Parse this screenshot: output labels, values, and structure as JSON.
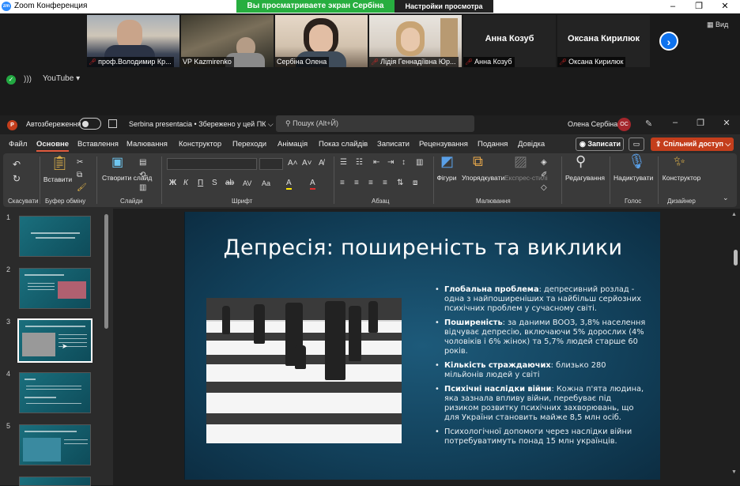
{
  "zoom": {
    "app_title": "Zoom Конференция",
    "app_icon": "zm",
    "share_banner": "Вы просматриваете экран Сербіна Олена",
    "view_settings": "Настройки просмотра",
    "participants": [
      {
        "name": "проф.Володимир Кр...",
        "muted": true,
        "has_video": true
      },
      {
        "name": "VP Kazmirenko",
        "muted": false,
        "has_video": true
      },
      {
        "name": "Сербіна Олена",
        "muted": false,
        "has_video": true
      },
      {
        "name": "Лідія Геннадіївна Юр...",
        "muted": true,
        "has_video": true
      },
      {
        "name": "Анна Козуб",
        "display_name": "Анна Козуб",
        "muted": true,
        "has_video": false
      },
      {
        "name": "Оксана Кирилюк",
        "display_name": "Оксана Кирилюк",
        "muted": true,
        "has_video": false
      }
    ],
    "next_arrow": "›",
    "view_label": "Вид",
    "youtube_label": "YouTube ▾",
    "window_controls": [
      "–",
      "❐",
      "✕"
    ]
  },
  "ppt": {
    "logo": "P",
    "autosave_label": "Автозбереження",
    "doc_title": "Serbina presentacia • Збережено у цей ПК ⌵",
    "search_placeholder": "Пошук (Alt+Й)",
    "user_name": "Олена Сербіна",
    "user_initials": "ОС",
    "window_controls": [
      "–",
      "❐",
      "✕"
    ],
    "menu": [
      "Файл",
      "Основне",
      "Вставлення",
      "Малювання",
      "Конструктор",
      "Переходи",
      "Анімація",
      "Показ слайдів",
      "Записати",
      "Рецензування",
      "Подання",
      "Довідка"
    ],
    "active_menu": "Основне",
    "record_label": "◉ Записати",
    "comment_label": "▭",
    "share_label": "⇪ Спільний доступ ⌵",
    "ribbon": {
      "undo_group": "Скасувати",
      "clipboard_group": "Буфер обміну",
      "paste_label": "Вставити",
      "slides_group": "Слайди",
      "new_slide_label": "Створити слайд",
      "font_group": "Шрифт",
      "paragraph_group": "Абзац",
      "drawing_group": "Малювання",
      "shapes_label": "Фігури",
      "arrange_label": "Упорядкувати",
      "quick_styles_label": "Експрес-стилі",
      "editing_group": "",
      "editing_label": "Редагування",
      "voice_group": "Голос",
      "dictate_label": "Надиктувати",
      "designer_group": "Дизайнер",
      "designer_label": "Конструктор",
      "font_buttons": [
        "Ж",
        "К",
        "П",
        "S",
        "ab",
        "AV",
        "Aa",
        "A",
        "A"
      ]
    },
    "slides": [
      {
        "num": "1"
      },
      {
        "num": "2"
      },
      {
        "num": "3"
      },
      {
        "num": "4"
      },
      {
        "num": "5"
      }
    ],
    "selected_slide": "3",
    "current_slide": {
      "title": "Депресія: поширеність та виклики",
      "bullets": [
        {
          "bold": "Глобальна проблема",
          "text": ": депресивний розлад - одна з найпоширеніших та найбільш серйозних психічних проблем у сучасному світі."
        },
        {
          "bold": "Поширеність",
          "text": ": за даними ВООЗ, 3,8% населення відчуває депресію, включаючи 5% дорослих (4% чоловіків і 6% жінок) та 5,7% людей старше 60 років."
        },
        {
          "bold": "Кількість страждаючих",
          "text": ": близько 280 мільйонів людей у світі"
        },
        {
          "bold": "Психічні наслідки війни",
          "text": ": Кожна п'ята людина, яка зазнала впливу війни, перебуває під ризиком розвитку психічних захворювань, що для України становить майже 8,5 млн осіб."
        },
        {
          "bold": "",
          "text": "Психологічної допомоги через наслідки війни потребуватимуть понад 15 млн українців."
        }
      ]
    }
  },
  "colors": {
    "zoom_green": "#27ae3f",
    "ppt_accent": "#c43e1c",
    "slide_bg": "#1d5a7a"
  }
}
